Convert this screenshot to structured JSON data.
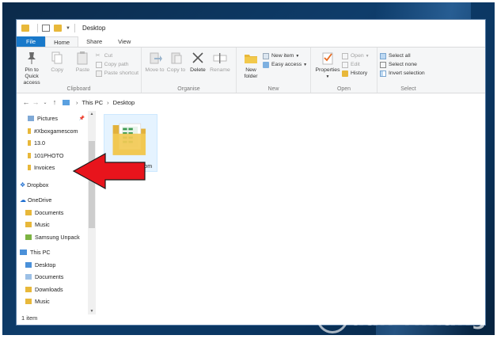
{
  "window": {
    "title": "Desktop"
  },
  "tabs": {
    "file": "File",
    "home": "Home",
    "share": "Share",
    "view": "View"
  },
  "ribbon": {
    "clipboard": {
      "label": "Clipboard",
      "pin": "Pin to Quick access",
      "copy": "Copy",
      "paste": "Paste",
      "cut": "Cut",
      "copy_path": "Copy path",
      "paste_shortcut": "Paste shortcut"
    },
    "organise": {
      "label": "Organise",
      "move_to": "Move to",
      "copy_to": "Copy to",
      "delete": "Delete",
      "rename": "Rename"
    },
    "new": {
      "label": "New",
      "new_folder": "New folder",
      "new_item": "New item",
      "easy_access": "Easy access"
    },
    "open": {
      "label": "Open",
      "properties": "Properties",
      "open": "Open",
      "edit": "Edit",
      "history": "History"
    },
    "select": {
      "label": "Select",
      "select_all": "Select all",
      "select_none": "Select none",
      "invert_selection": "Invert selection"
    }
  },
  "address": {
    "segments": [
      "This PC",
      "Desktop"
    ]
  },
  "nav": {
    "items": [
      {
        "label": "Pictures",
        "pinned": true
      },
      {
        "label": "#Xboxgamescom"
      },
      {
        "label": "13.0"
      },
      {
        "label": "101PHOTO"
      },
      {
        "label": "Invoices"
      },
      {
        "label": "Dropbox"
      },
      {
        "label": "OneDrive"
      },
      {
        "label": "Documents"
      },
      {
        "label": "Music"
      },
      {
        "label": "Samsung Unpack"
      },
      {
        "label": "This PC"
      },
      {
        "label": "Desktop"
      },
      {
        "label": "Documents"
      },
      {
        "label": "Downloads"
      },
      {
        "label": "Music"
      }
    ]
  },
  "files": [
    {
      "name": "#Xboxgamescom"
    }
  ],
  "status": {
    "count": "1 item"
  },
  "watermark": {
    "text": "uantrimang"
  },
  "colors": {
    "accent": "#1979ca",
    "arrow": "#e8141c",
    "folder": "#e8b83a"
  }
}
